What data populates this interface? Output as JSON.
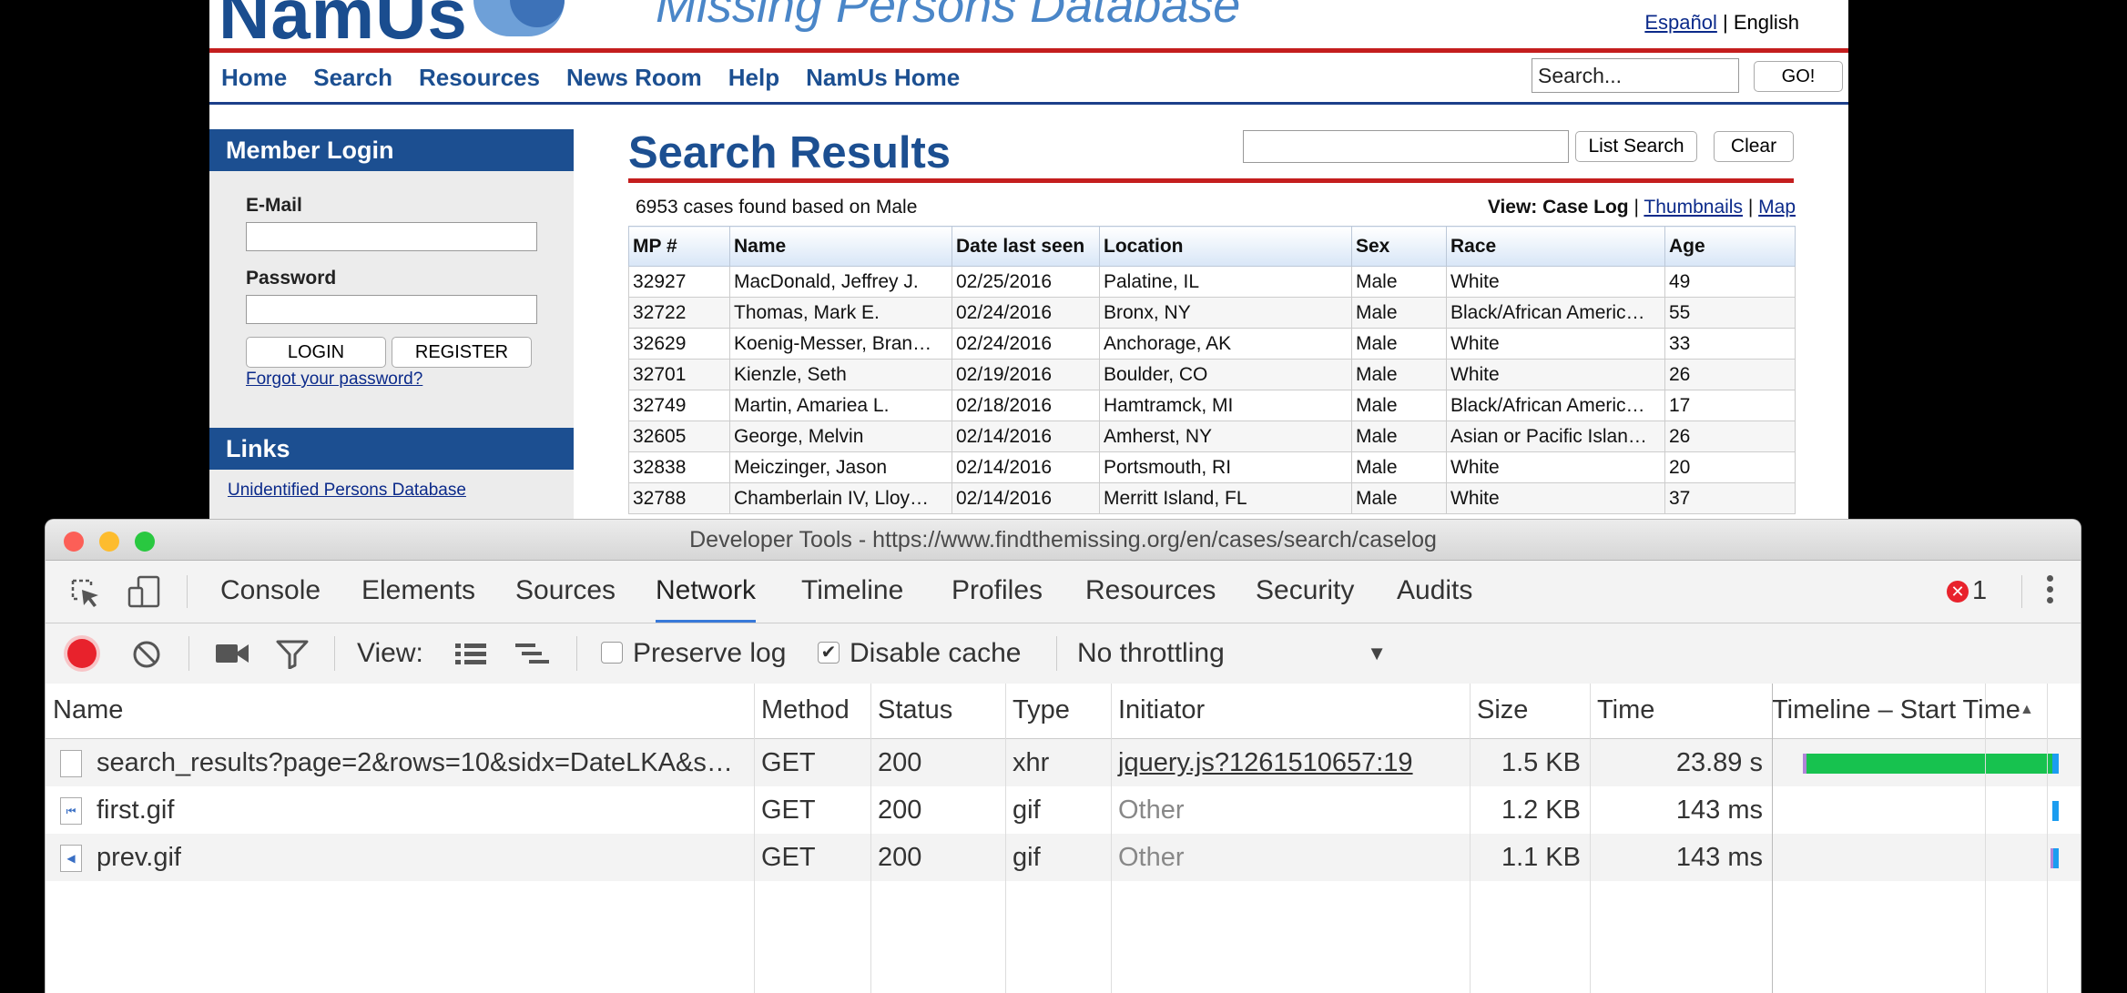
{
  "site": {
    "logo_text": "NamUs",
    "tagline": "Missing Persons Database",
    "lang": {
      "espanol": "Español",
      "separator": "|",
      "english": "English"
    },
    "nav": [
      "Home",
      "Search",
      "Resources",
      "News Room",
      "Help",
      "NamUs Home"
    ],
    "search_placeholder": "Search...",
    "go_label": "GO!",
    "sidebar": {
      "login_title": "Member Login",
      "email_label": "E-Mail",
      "password_label": "Password",
      "login_button": "LOGIN",
      "register_button": "REGISTER",
      "forgot_link": "Forgot your password?",
      "links_title": "Links",
      "links": [
        "Unidentified Persons Database"
      ]
    },
    "page_title": "Search Results",
    "list_search_button": "List Search",
    "clear_button": "Clear",
    "cases_found": "6953 cases found based on Male",
    "view": {
      "label": "View: Case Log",
      "sep": "|",
      "thumbnails": "Thumbnails",
      "map": "Map"
    },
    "table": {
      "columns": [
        "MP #",
        "Name",
        "Date last seen",
        "Location",
        "Sex",
        "Race",
        "Age"
      ],
      "rows": [
        [
          "32927",
          "MacDonald, Jeffrey J.",
          "02/25/2016",
          "Palatine, IL",
          "Male",
          "White",
          "49"
        ],
        [
          "32722",
          "Thomas, Mark E.",
          "02/24/2016",
          "Bronx, NY",
          "Male",
          "Black/African Americ…",
          "55"
        ],
        [
          "32629",
          "Koenig-Messer, Bran…",
          "02/24/2016",
          "Anchorage, AK",
          "Male",
          "White",
          "33"
        ],
        [
          "32701",
          "Kienzle, Seth",
          "02/19/2016",
          "Boulder, CO",
          "Male",
          "White",
          "26"
        ],
        [
          "32749",
          "Martin, Amariea L.",
          "02/18/2016",
          "Hamtramck, MI",
          "Male",
          "Black/African Americ…",
          "17"
        ],
        [
          "32605",
          "George, Melvin",
          "02/14/2016",
          "Amherst, NY",
          "Male",
          "Asian or Pacific Islan…",
          "26"
        ],
        [
          "32838",
          "Meiczinger, Jason",
          "02/14/2016",
          "Portsmouth, RI",
          "Male",
          "White",
          "20"
        ],
        [
          "32788",
          "Chamberlain IV, Lloy…",
          "02/14/2016",
          "Merritt Island, FL",
          "Male",
          "White",
          "37"
        ]
      ]
    }
  },
  "devtools": {
    "title": "Developer Tools - https://www.findthemissing.org/en/cases/search/caselog",
    "tabs": [
      "Console",
      "Elements",
      "Sources",
      "Network",
      "Timeline",
      "Profiles",
      "Resources",
      "Security",
      "Audits"
    ],
    "active_tab": "Network",
    "error_count": "1",
    "toolbar": {
      "view_label": "View:",
      "preserve_log": "Preserve log",
      "preserve_log_checked": false,
      "disable_cache": "Disable cache",
      "disable_cache_checked": true,
      "throttling": "No throttling"
    },
    "columns": [
      "Name",
      "Method",
      "Status",
      "Type",
      "Initiator",
      "Size",
      "Time",
      "Timeline – Start Time"
    ],
    "requests": [
      {
        "name": "search_results?page=2&rows=10&sidx=DateLKA&s…",
        "method": "GET",
        "status": "200",
        "type": "xhr",
        "initiator": "jquery.js?1261510657:19",
        "size": "1.5 KB",
        "time": "23.89 s"
      },
      {
        "name": "first.gif",
        "method": "GET",
        "status": "200",
        "type": "gif",
        "initiator": "Other",
        "size": "1.2 KB",
        "time": "143 ms"
      },
      {
        "name": "prev.gif",
        "method": "GET",
        "status": "200",
        "type": "gif",
        "initiator": "Other",
        "size": "1.1 KB",
        "time": "143 ms"
      }
    ],
    "colors": {
      "accent": "#3879d9",
      "record": "#e8222c",
      "timeline_green": "#17c24f",
      "timeline_blue": "#1b9df0"
    }
  }
}
